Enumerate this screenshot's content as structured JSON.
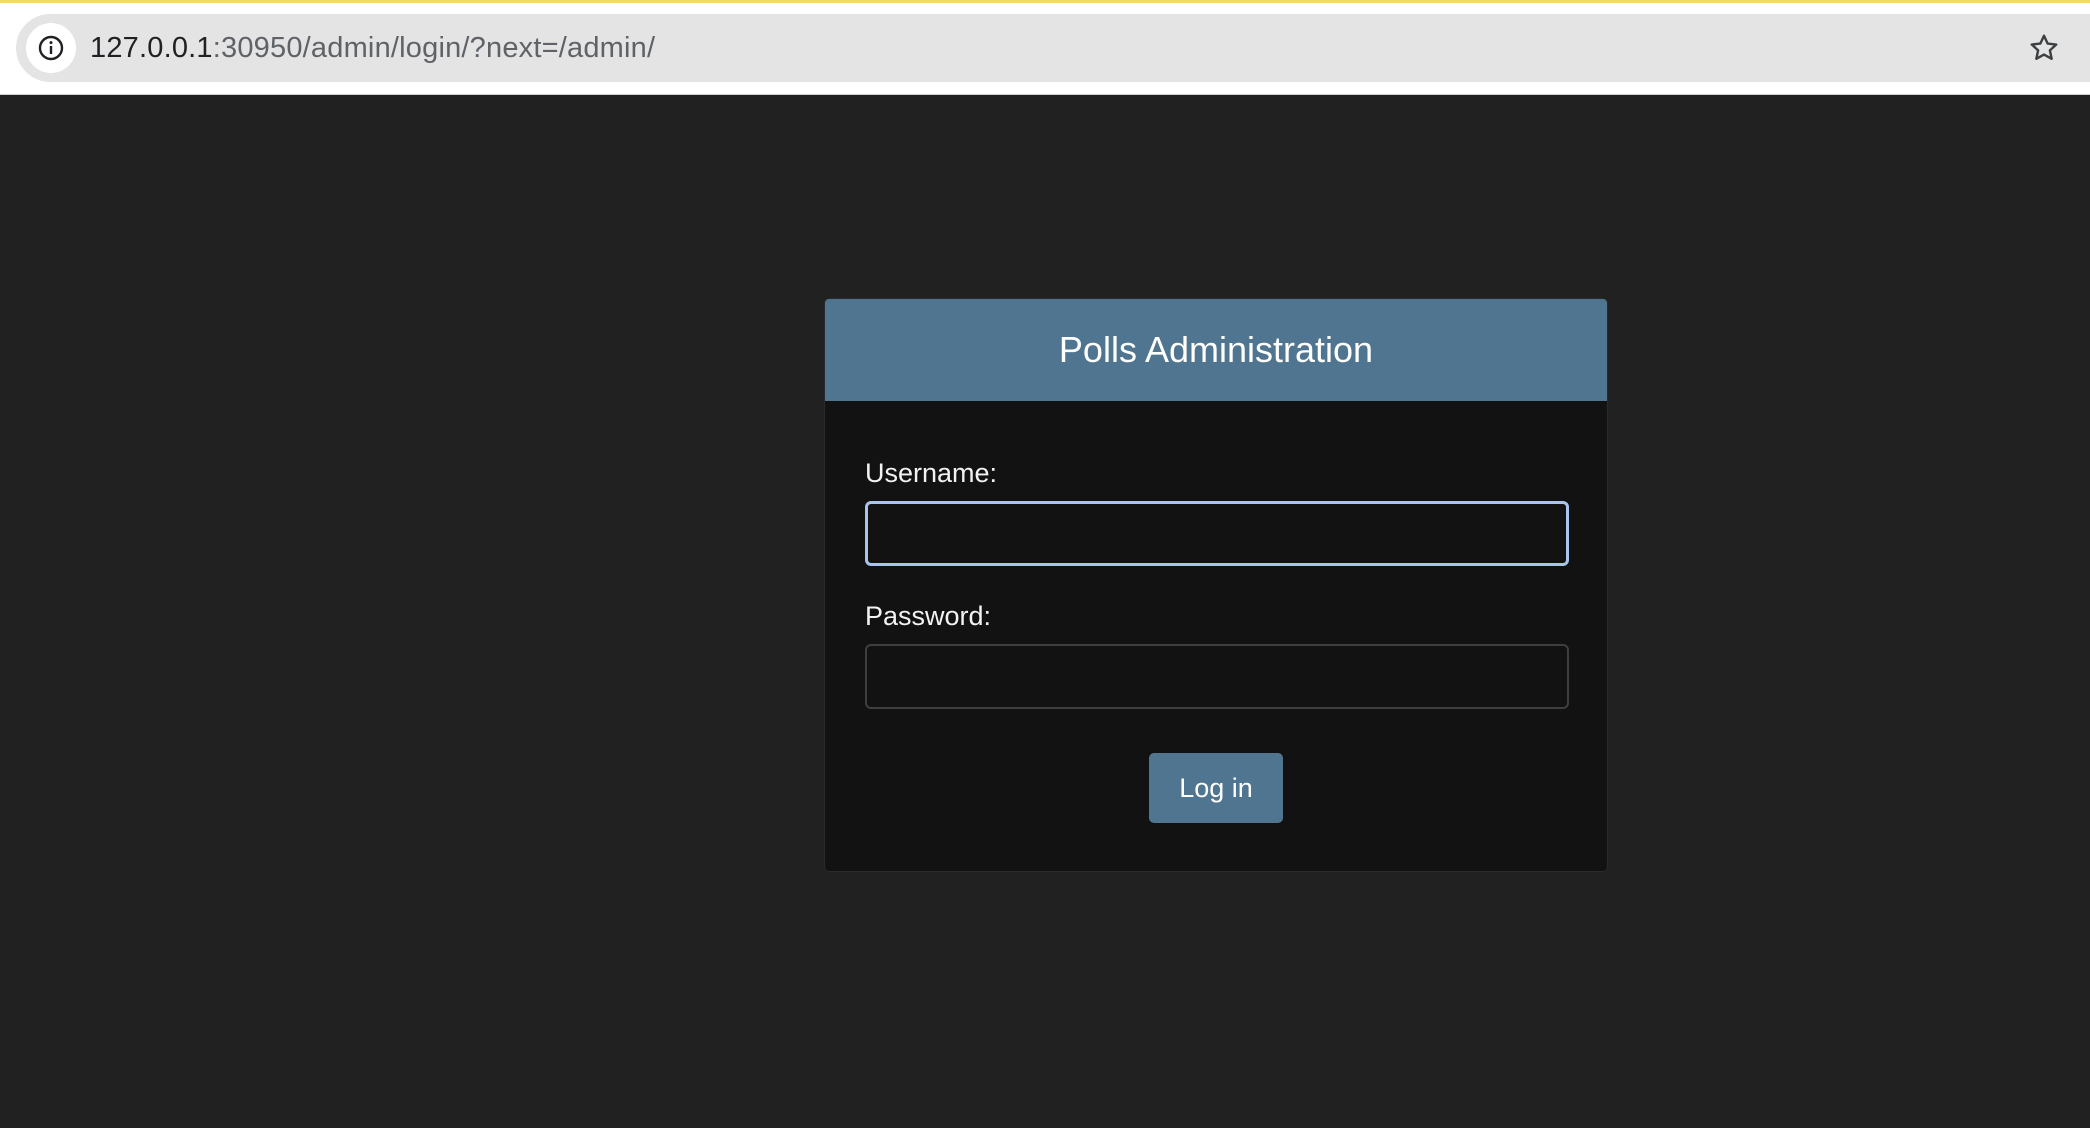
{
  "browser": {
    "url_host": "127.0.0.1",
    "url_rest": ":30950/admin/login/?next=/admin/",
    "site_info_icon": "info-circle-icon",
    "bookmark_icon": "star-icon"
  },
  "login": {
    "title": "Polls Administration",
    "username_label": "Username:",
    "username_value": "",
    "password_label": "Password:",
    "password_value": "",
    "submit_label": "Log in"
  },
  "colors": {
    "page_background": "#212121",
    "card_background": "#121212",
    "header_accent": "#4f7590",
    "focus_ring": "#a9c4ef"
  }
}
